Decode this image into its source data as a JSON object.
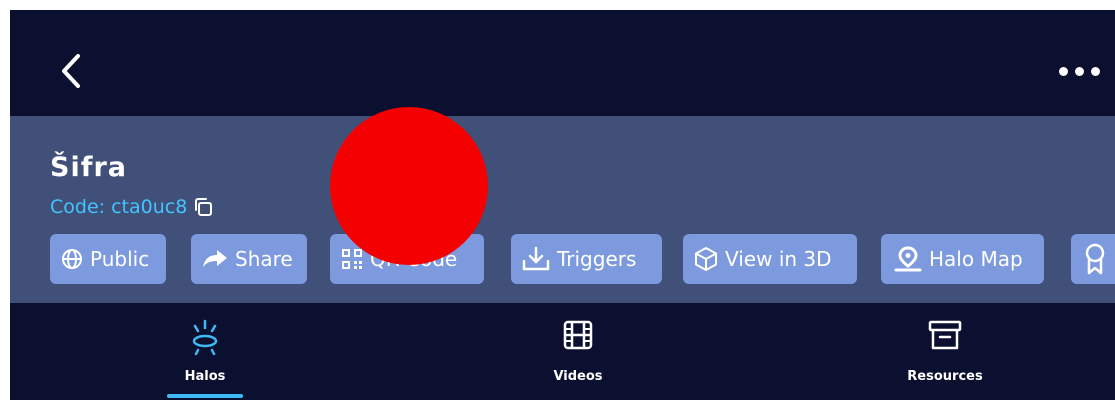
{
  "colors": {
    "background": "#0c1030",
    "info_panel": "#415078",
    "pill": "#7d9adf",
    "code_text": "#43c3ff",
    "accent": "#3dbaf5",
    "redaction": "#f50000"
  },
  "header": {
    "back_icon": "chevron-left-icon",
    "more_icon": "more-horizontal-icon"
  },
  "halo": {
    "title": "Šifra",
    "code": "Code: cta0uc8",
    "copy_icon": "copy-icon"
  },
  "actions": [
    {
      "label": "Public",
      "icon": "globe-icon"
    },
    {
      "label": "Share",
      "icon": "share-arrow-icon"
    },
    {
      "label": "QR Code",
      "icon": "qr-code-icon"
    },
    {
      "label": "Triggers",
      "icon": "download-icon"
    },
    {
      "label": "View in 3D",
      "icon": "cube-icon"
    },
    {
      "label": "Halo Map",
      "icon": "map-pin-icon"
    },
    {
      "label": "",
      "icon": "award-icon"
    }
  ],
  "tabs": [
    {
      "label": "Halos",
      "icon": "halo-icon",
      "active": true
    },
    {
      "label": "Videos",
      "icon": "film-icon",
      "active": false
    },
    {
      "label": "Resources",
      "icon": "archive-box-icon",
      "active": false
    }
  ]
}
